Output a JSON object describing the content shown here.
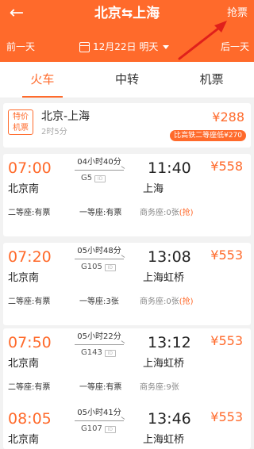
{
  "header": {
    "route_title": "北京⇆上海",
    "grab_ticket": "抢票",
    "prev_day": "前一天",
    "next_day": "后一天",
    "date": "12月22日 明天"
  },
  "tabs": [
    "火车",
    "中转",
    "机票"
  ],
  "flight": {
    "badge_line1": "特价",
    "badge_line2": "机票",
    "route": "北京-上海",
    "duration": "2时5分",
    "price": "¥288",
    "compare": "比高铁二等座低¥270"
  },
  "trains": [
    {
      "dep_time": "07:00",
      "arr_time": "11:40",
      "duration": "04小时40分",
      "train_no": "G5",
      "from": "北京南",
      "to": "上海",
      "price": "¥558",
      "seat1": "二等座:有票",
      "seat2": "一等座:有票",
      "seat3": "商务座:0张",
      "seat3_tag": "(抢)"
    },
    {
      "dep_time": "07:20",
      "arr_time": "13:08",
      "duration": "05小时48分",
      "train_no": "G105",
      "from": "北京南",
      "to": "上海虹桥",
      "price": "¥553",
      "seat1": "二等座:有票",
      "seat2": "一等座:3张",
      "seat3": "商务座:0张",
      "seat3_tag": "(抢)"
    },
    {
      "dep_time": "07:50",
      "arr_time": "13:12",
      "duration": "05小时22分",
      "train_no": "G143",
      "from": "北京南",
      "to": "上海虹桥",
      "price": "¥553",
      "seat1": "二等座:有票",
      "seat2": "一等座:有票",
      "seat3": "商务座:9张",
      "seat3_tag": ""
    },
    {
      "dep_time": "08:05",
      "arr_time": "13:46",
      "duration": "05小时41分",
      "train_no": "G107",
      "from": "北京南",
      "to": "上海虹桥",
      "price": "¥553",
      "seat1": "",
      "seat2": "",
      "seat3": "",
      "seat3_tag": ""
    }
  ],
  "colors": {
    "accent": "#ff6a2b",
    "annotation_arrow": "#e0201b"
  },
  "icons": {
    "back": "arrow-left-icon",
    "calendar": "calendar-icon",
    "dropdown": "caret-down-icon"
  }
}
